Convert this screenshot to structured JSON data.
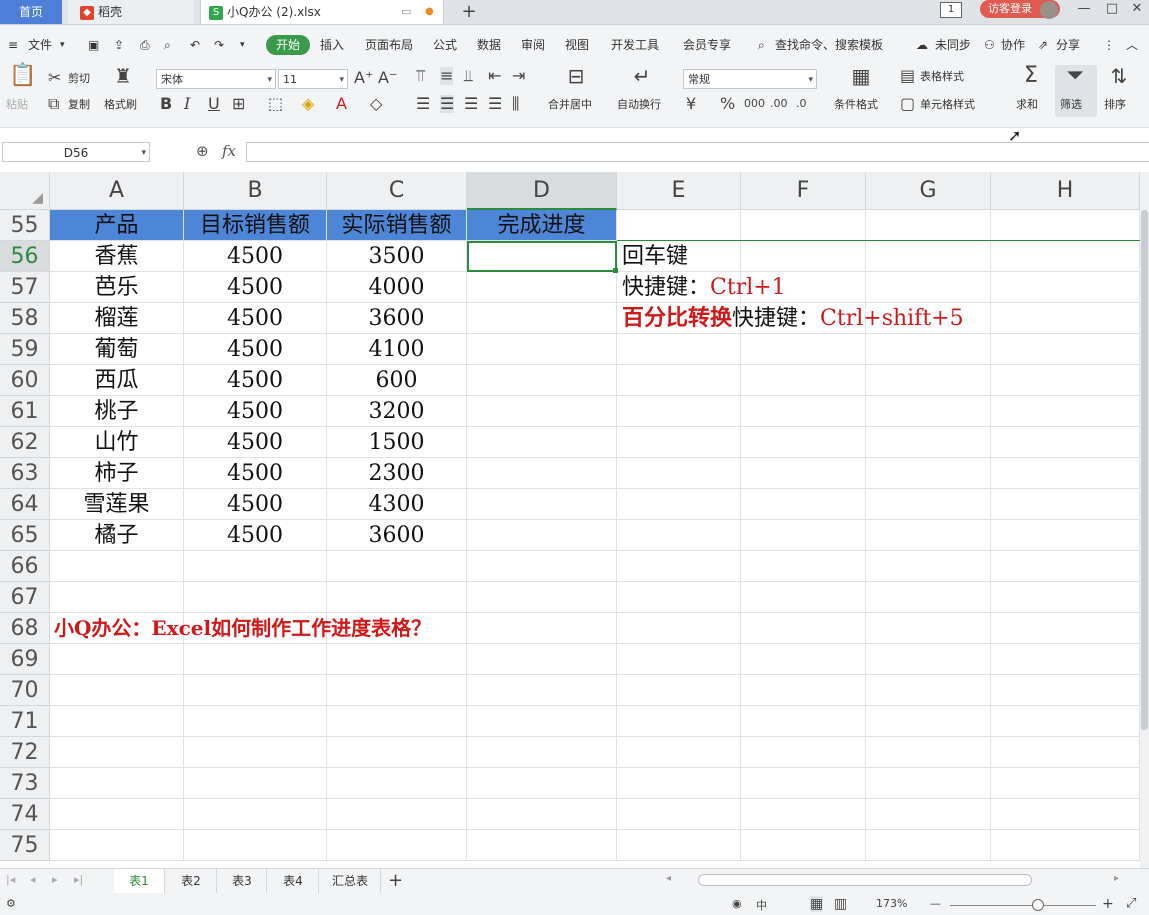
{
  "tabs": {
    "home": "首页",
    "daoke": "稻壳",
    "file": "小Q办公 (2).xlsx",
    "new_tab": "+",
    "page_count": "1",
    "guest_login": "访客登录"
  },
  "window": {
    "minimize": "—",
    "maximize": "□",
    "close": "✕"
  },
  "menu": {
    "file": "文件",
    "start": "开始",
    "insert": "插入",
    "layout": "页面布局",
    "formula": "公式",
    "data": "数据",
    "review": "审阅",
    "view": "视图",
    "devtools": "开发工具",
    "member": "会员专享",
    "search": "查找命令、搜索模板",
    "sync": "未同步",
    "collab": "协作",
    "share": "分享"
  },
  "ribbon": {
    "paste": "粘贴",
    "cut": "剪切",
    "copy": "复制",
    "format_painter": "格式刷",
    "font_name": "宋体",
    "font_size": "11",
    "merge_center": "合并居中",
    "wrap_text": "自动换行",
    "number_format": "常规",
    "conditional_format": "条件格式",
    "table_style": "表格样式",
    "cell_style": "单元格样式",
    "sum": "求和",
    "filter": "筛选",
    "sort": "排序"
  },
  "formula_bar": {
    "name_box": "D56",
    "fx": "fx",
    "value": ""
  },
  "columns": [
    "A",
    "B",
    "C",
    "D",
    "E",
    "F",
    "G",
    "H"
  ],
  "rows": [
    "55",
    "56",
    "57",
    "58",
    "59",
    "60",
    "61",
    "62",
    "63",
    "64",
    "65",
    "66",
    "67",
    "68",
    "69",
    "70",
    "71",
    "72",
    "73",
    "74",
    "75"
  ],
  "table": {
    "headers": [
      "产品",
      "目标销售额",
      "实际销售额",
      "完成进度"
    ],
    "rows": [
      [
        "香蕉",
        "4500",
        "3500",
        ""
      ],
      [
        "芭乐",
        "4500",
        "4000",
        ""
      ],
      [
        "榴莲",
        "4500",
        "3600",
        ""
      ],
      [
        "葡萄",
        "4500",
        "4100",
        ""
      ],
      [
        "西瓜",
        "4500",
        "600",
        ""
      ],
      [
        "桃子",
        "4500",
        "3200",
        ""
      ],
      [
        "山竹",
        "4500",
        "1500",
        ""
      ],
      [
        "柿子",
        "4500",
        "2300",
        ""
      ],
      [
        "雪莲果",
        "4500",
        "4300",
        ""
      ],
      [
        "橘子",
        "4500",
        "3600",
        ""
      ]
    ]
  },
  "notes": {
    "enter_key": "回车键",
    "shortcut_label": "快捷键：",
    "shortcut_1": "Ctrl+1",
    "percent_label": "百分比转换",
    "shortcut_label_2": "快捷键：",
    "shortcut_2": "Ctrl+shift+5",
    "title": "小Q办公：Excel如何制作工作进度表格？"
  },
  "sheets": [
    "表1",
    "表2",
    "表3",
    "表4",
    "汇总表"
  ],
  "add_sheet": "+",
  "status": {
    "zoom": "173%",
    "lang": "中",
    "zoom_minus": "—",
    "zoom_plus": "+"
  },
  "colors": {
    "header_fill": "#4d86d6",
    "accent_red": "#d01818",
    "start_green": "#3a9a4c",
    "tab_blue": "#4e7fd8"
  }
}
